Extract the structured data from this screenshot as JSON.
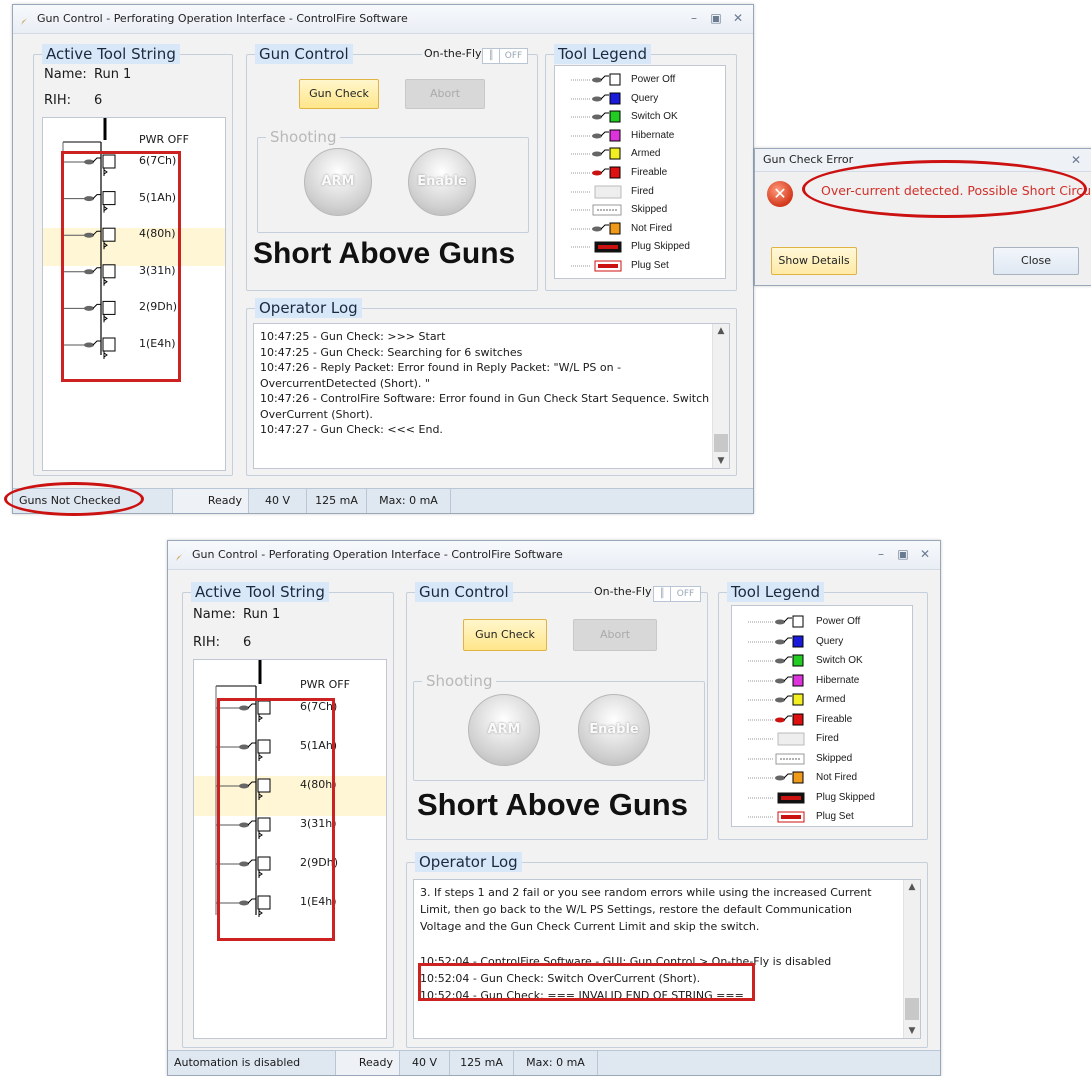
{
  "windows": [
    {
      "title": "Gun Control - Perforating Operation Interface - ControlFire Software",
      "tool_string": {
        "title": "Active Tool String",
        "name_label": "Name:",
        "name_value": "Run 1",
        "rih_label": "RIH:",
        "rih_value": "6",
        "pwr_off": "PWR OFF",
        "switches": [
          "6(7Ch)",
          "5(1Ah)",
          "4(80h)",
          "3(31h)",
          "2(9Dh)",
          "1(E4h)"
        ]
      },
      "gun_control": {
        "title": "Gun Control",
        "on_the_fly": "On-the-Fly",
        "toggle_off": "OFF",
        "gun_check": "Gun Check",
        "abort": "Abort",
        "shooting": "Shooting",
        "arm": "ARM",
        "enable": "Enable",
        "big_message": "Short Above Guns"
      },
      "legend": {
        "title": "Tool Legend",
        "items": [
          "Power Off",
          "Query",
          "Switch OK",
          "Hibernate",
          "Armed",
          "Fireable",
          "Fired",
          "Skipped",
          "Not Fired",
          "Plug Skipped",
          "Plug Set"
        ]
      },
      "operator_log": {
        "title": "Operator Log",
        "lines": [
          "10:47:25 - Gun Check: >>> Start",
          "10:47:25 - Gun Check: Searching for 6 switches",
          "10:47:26 - Reply Packet: Error found in Reply Packet: \"W/L PS on -",
          "OvercurrentDetected (Short). \"",
          "10:47:26 - ControlFire Software: Error found in Gun Check Start Sequence. Switch",
          "OverCurrent (Short).",
          "10:47:27 - Gun Check: <<< End."
        ]
      },
      "status": {
        "left": "Guns Not Checked",
        "state": "Ready",
        "voltage": "40 V",
        "current": "125 mA",
        "max": "Max: 0 mA"
      }
    },
    {
      "title": "Gun Control - Perforating Operation Interface - ControlFire Software",
      "tool_string": {
        "title": "Active Tool String",
        "name_label": "Name:",
        "name_value": "Run 1",
        "rih_label": "RIH:",
        "rih_value": "6",
        "pwr_off": "PWR OFF",
        "switches": [
          "6(7Ch)",
          "5(1Ah)",
          "4(80h)",
          "3(31h)",
          "2(9Dh)",
          "1(E4h)"
        ]
      },
      "gun_control": {
        "title": "Gun Control",
        "on_the_fly": "On-the-Fly",
        "toggle_off": "OFF",
        "gun_check": "Gun Check",
        "abort": "Abort",
        "shooting": "Shooting",
        "arm": "ARM",
        "enable": "Enable",
        "big_message": "Short Above Guns"
      },
      "legend": {
        "title": "Tool Legend",
        "items": [
          "Power Off",
          "Query",
          "Switch OK",
          "Hibernate",
          "Armed",
          "Fireable",
          "Fired",
          "Skipped",
          "Not Fired",
          "Plug Skipped",
          "Plug Set"
        ]
      },
      "operator_log": {
        "title": "Operator Log",
        "lines": [
          "3. If steps 1 and 2 fail or you see random errors while using the increased Current",
          "Limit, then go back to the W/L PS Settings, restore the default Communication",
          "Voltage and the Gun Check Current Limit and skip the switch.",
          "",
          "10:52:04 - ControlFire Software - GUI: Gun Control > On-the-Fly is disabled",
          "10:52:04 - Gun Check:  Switch OverCurrent (Short).",
          "10:52:04 - Gun Check: === INVALID END OF STRING ==="
        ]
      },
      "status": {
        "left": "Automation is disabled",
        "state": "Ready",
        "voltage": "40 V",
        "current": "125 mA",
        "max": "Max: 0 mA"
      }
    }
  ],
  "dialog": {
    "title": "Gun Check Error",
    "message": "Over-current detected. Possible Short Circuit",
    "show_details": "Show Details",
    "close": "Close"
  },
  "legend_colors": [
    "#ffffff",
    "#1a1adb",
    "#22cc22",
    "#dd33dd",
    "#f2ee22",
    "#dd1111",
    "#e8e8e8",
    "#ffffff",
    "#f09a1a",
    "#ffffff",
    "#ffffff"
  ],
  "accent": "#cc2222"
}
